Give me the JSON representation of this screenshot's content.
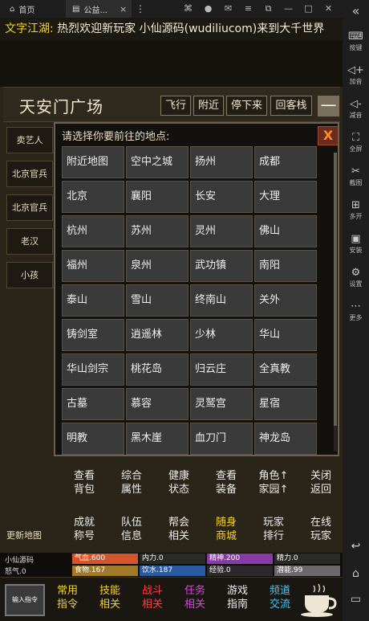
{
  "browser": {
    "home_tab": "首页",
    "app_tab": "公益...",
    "close_glyph": "×",
    "menu_glyph": "⋮"
  },
  "side_toolbar": {
    "collapse_glyph": "«",
    "items": [
      {
        "label": "按键",
        "icon": "keyboard-icon"
      },
      {
        "label": "加音",
        "icon": "volume-up-icon"
      },
      {
        "label": "减音",
        "icon": "volume-down-icon"
      },
      {
        "label": "全屏",
        "icon": "fullscreen-icon"
      },
      {
        "label": "截图",
        "icon": "scissors-icon"
      },
      {
        "label": "多开",
        "icon": "multi-open-icon"
      },
      {
        "label": "安装",
        "icon": "apk-icon"
      },
      {
        "label": "设置",
        "icon": "gear-icon"
      },
      {
        "label": "更多",
        "icon": "more-icon"
      }
    ]
  },
  "marquee": {
    "channel": "文字江湖:",
    "message": "热烈欢迎新玩家 小仙源码(wudiliucom)来到大千世界"
  },
  "location": {
    "title": "天安门广场",
    "buttons": [
      "飞行",
      "附近",
      "停下来",
      "回客栈"
    ],
    "minimize": "—"
  },
  "npcs": [
    "卖艺人",
    "北京官兵",
    "北京官兵",
    "老汉",
    "小孩"
  ],
  "update_map": "更新地图",
  "dialog": {
    "prompt": "请选择你要前往的地点:",
    "close": "X",
    "places": [
      "附近地图",
      "空中之城",
      "扬州",
      "成都",
      "北京",
      "襄阳",
      "长安",
      "大理",
      "杭州",
      "苏州",
      "灵州",
      "佛山",
      "福州",
      "泉州",
      "武功镇",
      "南阳",
      "泰山",
      "雪山",
      "终南山",
      "关外",
      "铸剑室",
      "逍遥林",
      "少林",
      "华山",
      "华山剑宗",
      "桃花岛",
      "归云庄",
      "全真教",
      "古墓",
      "慕容",
      "灵鹫宫",
      "星宿",
      "明教",
      "黑木崖",
      "血刀门",
      "神龙岛"
    ]
  },
  "commands": [
    [
      "查看",
      "背包"
    ],
    [
      "综合",
      "属性"
    ],
    [
      "健康",
      "状态"
    ],
    [
      "查看",
      "装备"
    ],
    [
      "角色↑",
      "家园↑"
    ],
    [
      "关闭",
      "返回"
    ],
    [
      "成就",
      "称号"
    ],
    [
      "队伍",
      "信息"
    ],
    [
      "帮会",
      "相关"
    ],
    [
      "随身",
      "商城"
    ],
    [
      "玩家",
      "排行"
    ],
    [
      "在线",
      "玩家"
    ]
  ],
  "status": {
    "player_name": "小仙源码",
    "anger": "怒气.0",
    "bars": [
      {
        "label": "气血.600",
        "fraction": 1.0,
        "color": "#d4552a"
      },
      {
        "label": "内力.0",
        "fraction": 0.0,
        "color": "#3a6fd0"
      },
      {
        "label": "精神.200",
        "fraction": 1.0,
        "color": "#8a3aa8"
      },
      {
        "label": "精力.0",
        "fraction": 0.0,
        "color": "#3a9a3a"
      },
      {
        "label": "食物.167",
        "fraction": 1.0,
        "color": "#a07a2a"
      },
      {
        "label": "饮水.187",
        "fraction": 1.0,
        "color": "#2a5aa0"
      },
      {
        "label": "经验.0",
        "fraction": 0.0,
        "color": "#5a5a5a"
      },
      {
        "label": "潜能.99",
        "fraction": 1.0,
        "color": "#6a6a6a"
      }
    ]
  },
  "bottom": {
    "input_label": "输入指令",
    "buttons": [
      {
        "l1": "常用",
        "l2": "指令",
        "color": "#f2d32c"
      },
      {
        "l1": "技能",
        "l2": "相关",
        "color": "#f2d32c"
      },
      {
        "l1": "战斗",
        "l2": "相关",
        "color": "#ff4040"
      },
      {
        "l1": "任务",
        "l2": "相关",
        "color": "#e040e0"
      },
      {
        "l1": "游戏",
        "l2": "指南",
        "color": "#f0f0f0"
      },
      {
        "l1": "频道",
        "l2": "交流",
        "color": "#40c8ff"
      }
    ]
  },
  "colors": {
    "accent": "#f2d32c",
    "dialog_close": "#ff8a2a"
  }
}
